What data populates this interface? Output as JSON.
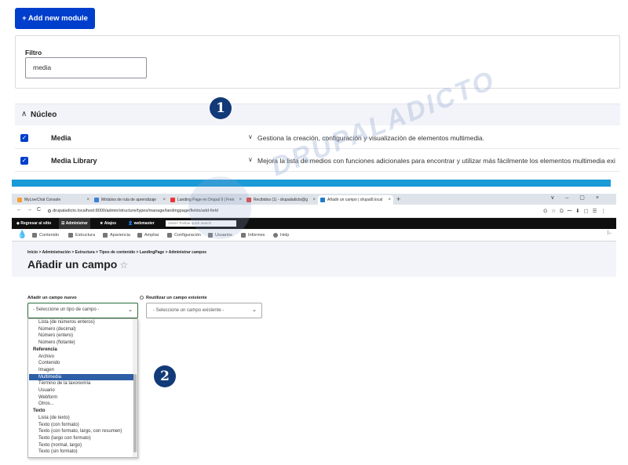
{
  "extend_page": {
    "add_module_label": "+ Add new module",
    "filter_label": "Filtro",
    "filter_value": "media",
    "section_title": "Núcleo",
    "modules": [
      {
        "name": "Media",
        "description": "Gestiona la creación, configuración y visualización de elementos multimedia."
      },
      {
        "name": "Media Library",
        "description": "Mejora la lista de medios con funciones adicionales para encontrar y utilizar más fácilmente los elementos multimedia exi"
      }
    ]
  },
  "watermark": "DRUPALADICTO",
  "steps": [
    "1",
    "2"
  ],
  "browser": {
    "tabs": [
      {
        "title": "MyLiveChat Console",
        "color": "#f4a030"
      },
      {
        "title": "Módulos de ruta de aprendizaje",
        "color": "#3b7fd4"
      },
      {
        "title": "Landing Page en Drupal 9 | Fren",
        "color": "#e33"
      },
      {
        "title": "Recibidos (1) - drupaladicto@g",
        "color": "#d44"
      },
      {
        "title": "Añadir un campo | drupal9.local",
        "color": "#1d7ac8"
      }
    ],
    "new_tab": "+",
    "url": "drupaladicto.localhost:8000/admin/structure/types/manage/landingpage/fields/add-field",
    "admin_bar": {
      "back": "Regresar al sitio",
      "manage": "Administrar",
      "shortcuts": "Atajos",
      "user": "webmaster",
      "search_placeholder": "Admin Toolbar quick search"
    },
    "tray": [
      "Contenido",
      "Estructura",
      "Apariencia",
      "Ampliar",
      "Configuración",
      "Usuarios",
      "Informes",
      "Help"
    ],
    "breadcrumb": "Inicio  >  Administración  >  Estructura  >  Tipos de contenido  >  LandingPage  >  Administrar campos",
    "page_title": "Añadir un campo",
    "star": "☆"
  },
  "field_form": {
    "new_field_label": "Añadir un campo nuevo",
    "new_field_value": "- Seleccione un tipo de campo -",
    "reuse_label": "Reutilizar un campo existente",
    "reuse_value": "- Seleccione un campo existente -",
    "options": [
      {
        "type": "item",
        "label": "Lista (de números enteros)"
      },
      {
        "type": "item",
        "label": "Número (decimal)"
      },
      {
        "type": "item",
        "label": "Número (entero)"
      },
      {
        "type": "item",
        "label": "Número (flotante)"
      },
      {
        "type": "group",
        "label": "Referencia"
      },
      {
        "type": "item",
        "label": "Archivo"
      },
      {
        "type": "item",
        "label": "Contenido"
      },
      {
        "type": "item",
        "label": "Imagen"
      },
      {
        "type": "item",
        "label": "Multimedia",
        "selected": true
      },
      {
        "type": "item",
        "label": "Término de la taxonomía"
      },
      {
        "type": "item",
        "label": "Usuario"
      },
      {
        "type": "item",
        "label": "Webform"
      },
      {
        "type": "item",
        "label": "Otros..."
      },
      {
        "type": "group",
        "label": "Texto"
      },
      {
        "type": "item",
        "label": "Lista (de texto)"
      },
      {
        "type": "item",
        "label": "Texto (con formato)"
      },
      {
        "type": "item",
        "label": "Texto (con formato, largo, con resumen)"
      },
      {
        "type": "item",
        "label": "Texto (largo con formato)"
      },
      {
        "type": "item",
        "label": "Texto (normal, largo)"
      },
      {
        "type": "item",
        "label": "Texto (sin formato)"
      }
    ]
  }
}
